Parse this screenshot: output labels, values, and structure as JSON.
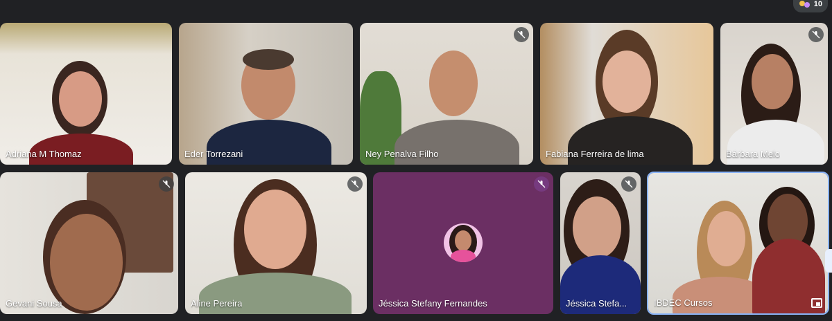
{
  "meeting": {
    "participant_count": "10"
  },
  "participants": [
    {
      "name": "Adriana M Thomaz",
      "muted": false
    },
    {
      "name": "Eder Torrezani",
      "muted": false
    },
    {
      "name": "Ney Penalva Filho",
      "muted": true
    },
    {
      "name": "Fabiana Ferreira de lima",
      "muted": false
    },
    {
      "name": "Bárbara Melo",
      "muted": true
    },
    {
      "name": "Gevani Sousa",
      "muted": true
    },
    {
      "name": "Aline Pereira",
      "muted": true
    },
    {
      "name": "Jéssica Stefany Fernandes",
      "muted": true
    },
    {
      "name": "Jéssica Stefa...",
      "muted": true
    },
    {
      "name": "IBDEC Cursos",
      "muted": false
    }
  ],
  "colors": {
    "meeting_bg": "#202124",
    "avatar_tile": "#6b2f63",
    "active_border": "#8ab4f8"
  }
}
